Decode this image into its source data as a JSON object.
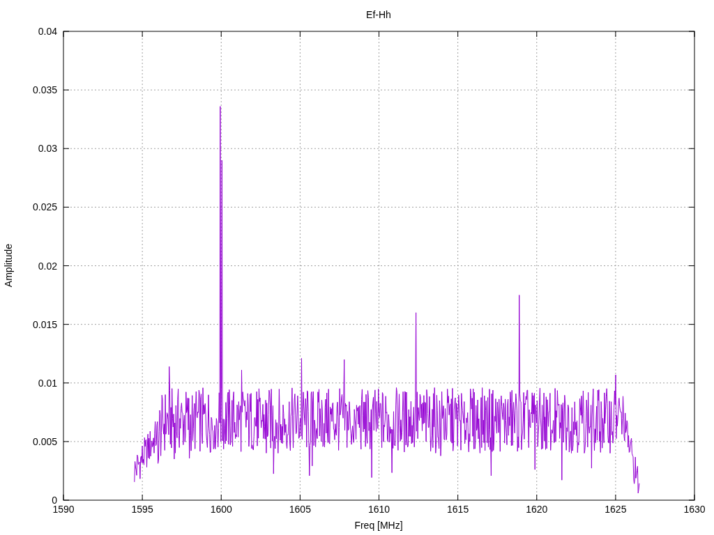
{
  "chart": {
    "title": "Ef-Hh",
    "xlabel": "Freq [MHz]",
    "ylabel": "Amplitude",
    "xticks": [
      "1590",
      "1595",
      "1600",
      "1605",
      "1610",
      "1615",
      "1620",
      "1625",
      "1630"
    ],
    "yticks": [
      "0.04",
      "0.035",
      "0.03",
      "0.025",
      "0.02",
      "0.015",
      "0.01",
      "0.005",
      "0"
    ]
  }
}
